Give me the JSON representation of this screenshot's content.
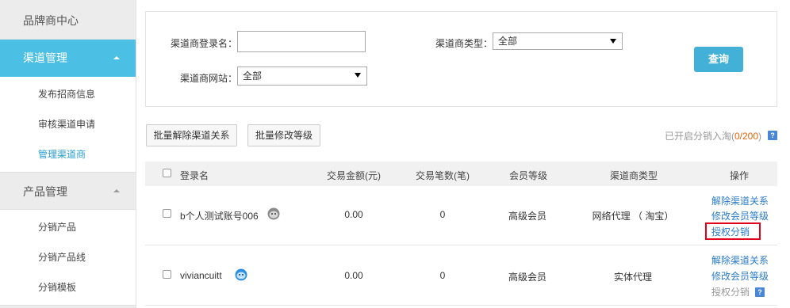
{
  "sidebar": {
    "header": "品牌商中心",
    "groups": [
      {
        "label": "渠道管理",
        "items": [
          "发布招商信息",
          "审核渠道申请",
          "管理渠道商"
        ]
      },
      {
        "label": "产品管理",
        "items": [
          "分销产品",
          "分销产品线",
          "分销模板"
        ]
      }
    ]
  },
  "filter": {
    "login_label": "渠道商登录名：",
    "login_value": "",
    "type_label": "渠道商类型：",
    "type_value": "全部",
    "site_label": "渠道商网站：",
    "site_value": "全部",
    "query_button": "查询"
  },
  "toolbar": {
    "batch_unbind": "批量解除渠道关系",
    "batch_level": "批量修改等级",
    "dist_prefix": "已开启分销入淘(",
    "dist_count": "0/200",
    "dist_suffix": ")",
    "help": "?"
  },
  "table": {
    "headers": [
      "登录名",
      "交易金额(元)",
      "交易笔数(笔)",
      "会员等级",
      "渠道商类型",
      "操作"
    ],
    "rows": [
      {
        "login": "b个人测试账号006",
        "amount": "0.00",
        "count": "0",
        "level": "高级会员",
        "type": "网络代理 （ 淘宝）",
        "ops": [
          "解除渠道关系",
          "修改会员等级",
          "授权分销"
        ]
      },
      {
        "login": "viviancuitt",
        "amount": "0.00",
        "count": "0",
        "level": "高级会员",
        "type": "实体代理",
        "ops": [
          "解除渠道关系",
          "修改会员等级",
          "授权分销"
        ]
      }
    ]
  },
  "colors": {
    "accent": "#4bbfe4",
    "link": "#2a7cc7",
    "highlight": "#e2001a",
    "count": "#e8630a"
  }
}
